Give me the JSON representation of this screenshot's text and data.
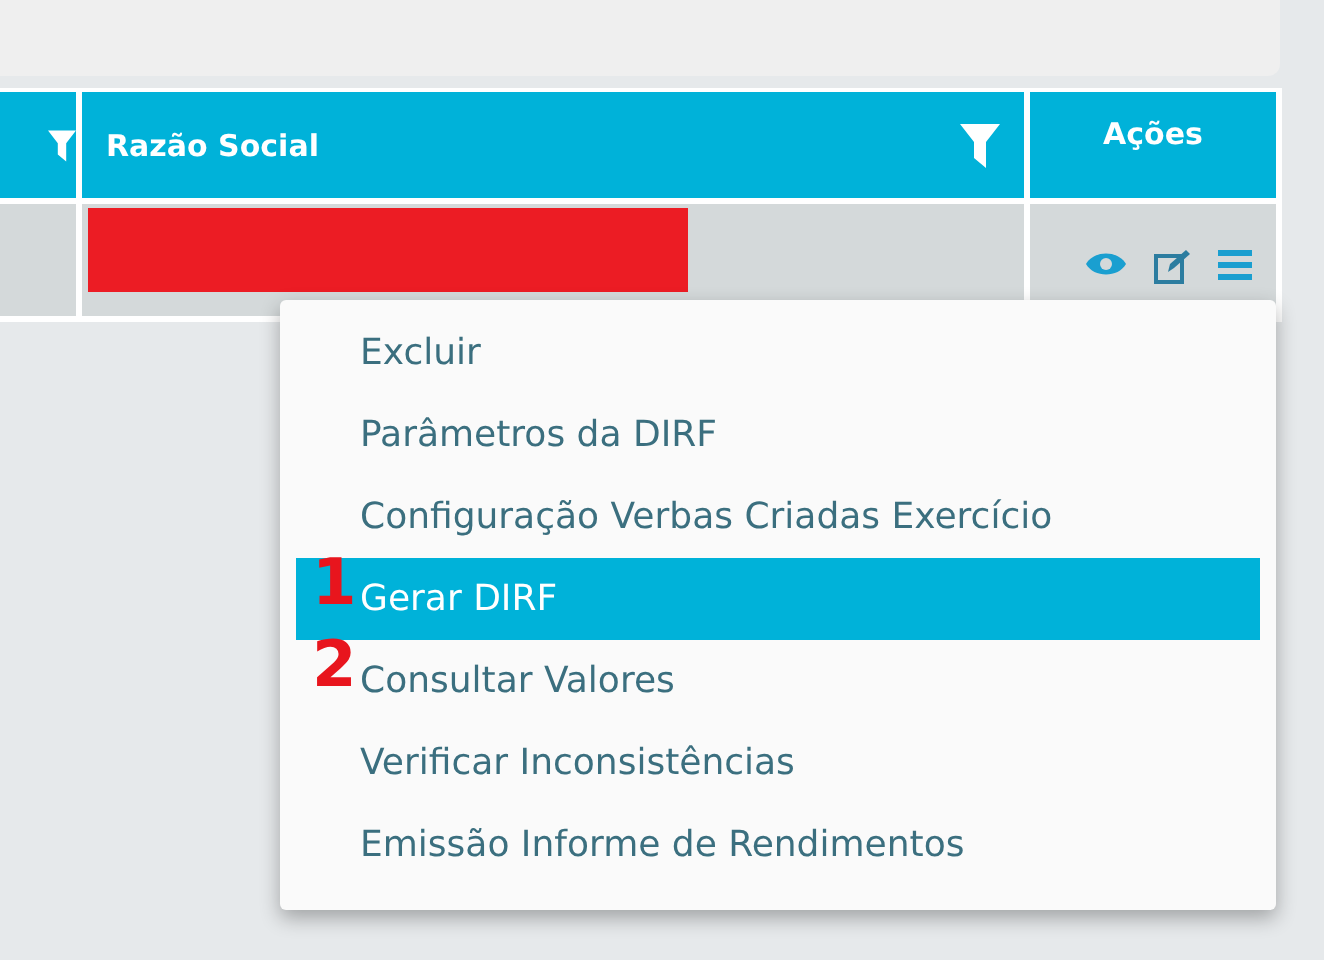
{
  "table": {
    "columns": [
      {
        "kind": "filter-only"
      },
      {
        "kind": "filter",
        "label": "Razão Social"
      },
      {
        "kind": "plain",
        "label": "Ações"
      }
    ],
    "rows": [
      {
        "name": {
          "kind": "redacted"
        },
        "actions": [
          {
            "kind": "view"
          },
          {
            "kind": "edit"
          },
          {
            "kind": "menu"
          }
        ]
      }
    ]
  },
  "context_menu": {
    "items": [
      {
        "label": "Excluir",
        "selected": false
      },
      {
        "label": "Parâmetros da DIRF",
        "selected": false
      },
      {
        "label": "Configuração Verbas Criadas Exercício",
        "selected": false
      },
      {
        "label": "Gerar DIRF",
        "selected": true,
        "marker": "1"
      },
      {
        "label": "Consultar Valores",
        "selected": false,
        "marker": "2"
      },
      {
        "label": "Verificar Inconsistências",
        "selected": false
      },
      {
        "label": "Emissão Informe de Rendimentos",
        "selected": false
      }
    ]
  }
}
